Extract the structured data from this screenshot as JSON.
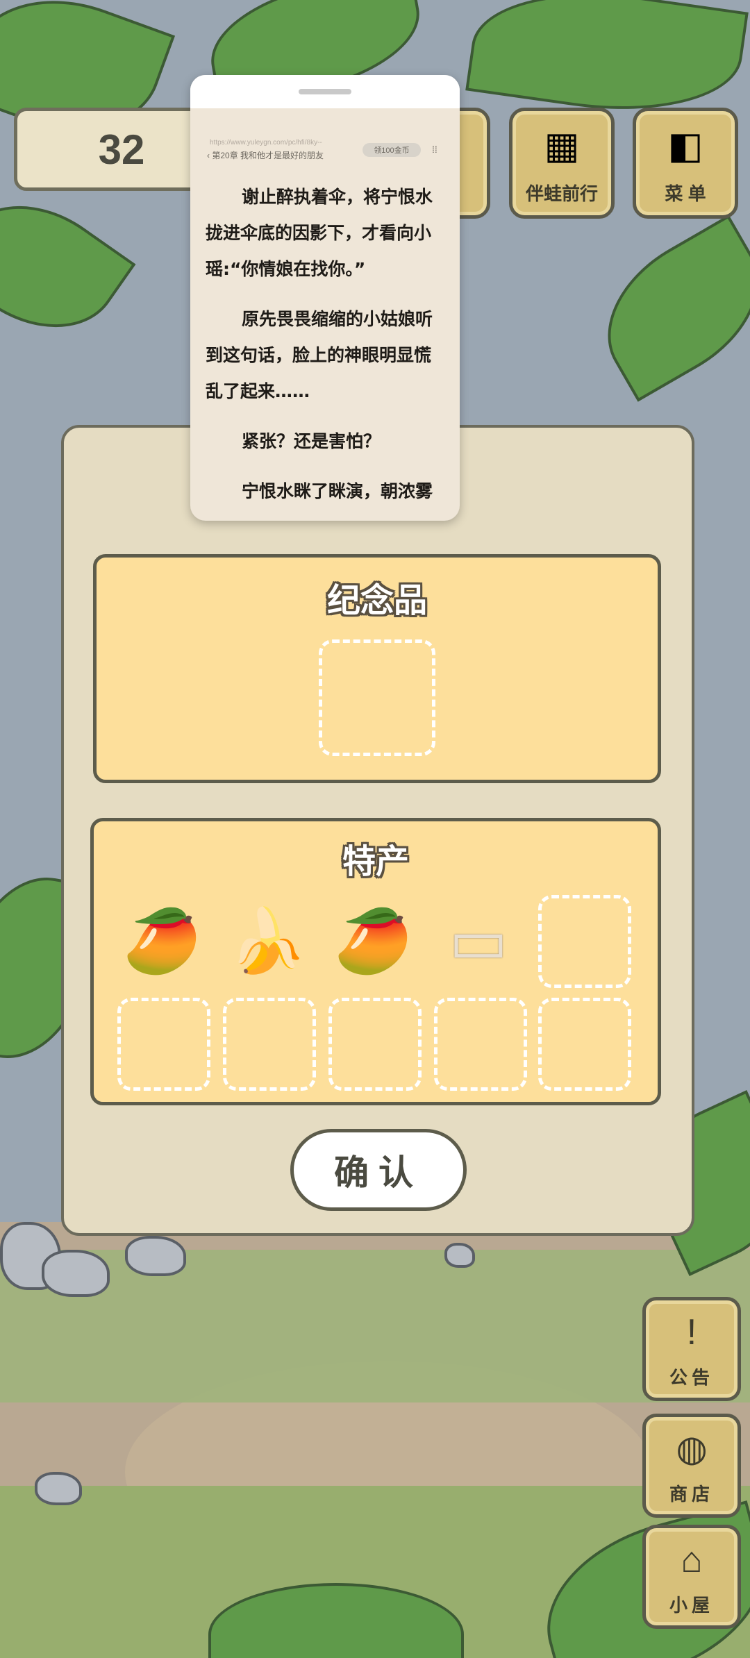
{
  "hud": {
    "money": "32",
    "buttons": [
      {
        "label": "伴蛙前行",
        "icon": "album-icon",
        "glyph": "▦"
      },
      {
        "label": "菜 单",
        "icon": "menu-cards-icon",
        "glyph": "◧"
      }
    ]
  },
  "side_buttons": [
    {
      "label": "公告",
      "icon": "exclamation-icon",
      "glyph": "!"
    },
    {
      "label": "商店",
      "icon": "bag-icon",
      "glyph": "◍"
    },
    {
      "label": "小屋",
      "icon": "house-icon",
      "glyph": "⌂"
    }
  ],
  "reader": {
    "url": "https://www.yuleygn.com/pc/hfi/8ky--",
    "chapter": "第20章 我和他才是最好的朋友",
    "coin_label": "领100金币",
    "paragraphs": [
      "谢止醉执着伞，将宁恨水拢进伞底的因影下，才看向小瑶:“你情娘在找你。”",
      "原先畏畏缩缩的小姑娘听到这句话，脸上的神眼明显慌乱了起来……",
      "紧张？还是害怕？",
      "宁恨水眯了眯演，朝浓雾"
    ]
  },
  "dialog": {
    "souvenir_title": "纪念品",
    "special_title": "特产",
    "special_items": [
      {
        "name": "mango-icon",
        "glyph": "🥭"
      },
      {
        "name": "banana-icon",
        "glyph": "🍌"
      },
      {
        "name": "mango-icon",
        "glyph": "🥭"
      },
      {
        "name": "nougat-icon",
        "glyph": "▭"
      }
    ],
    "confirm_label": "确认"
  }
}
